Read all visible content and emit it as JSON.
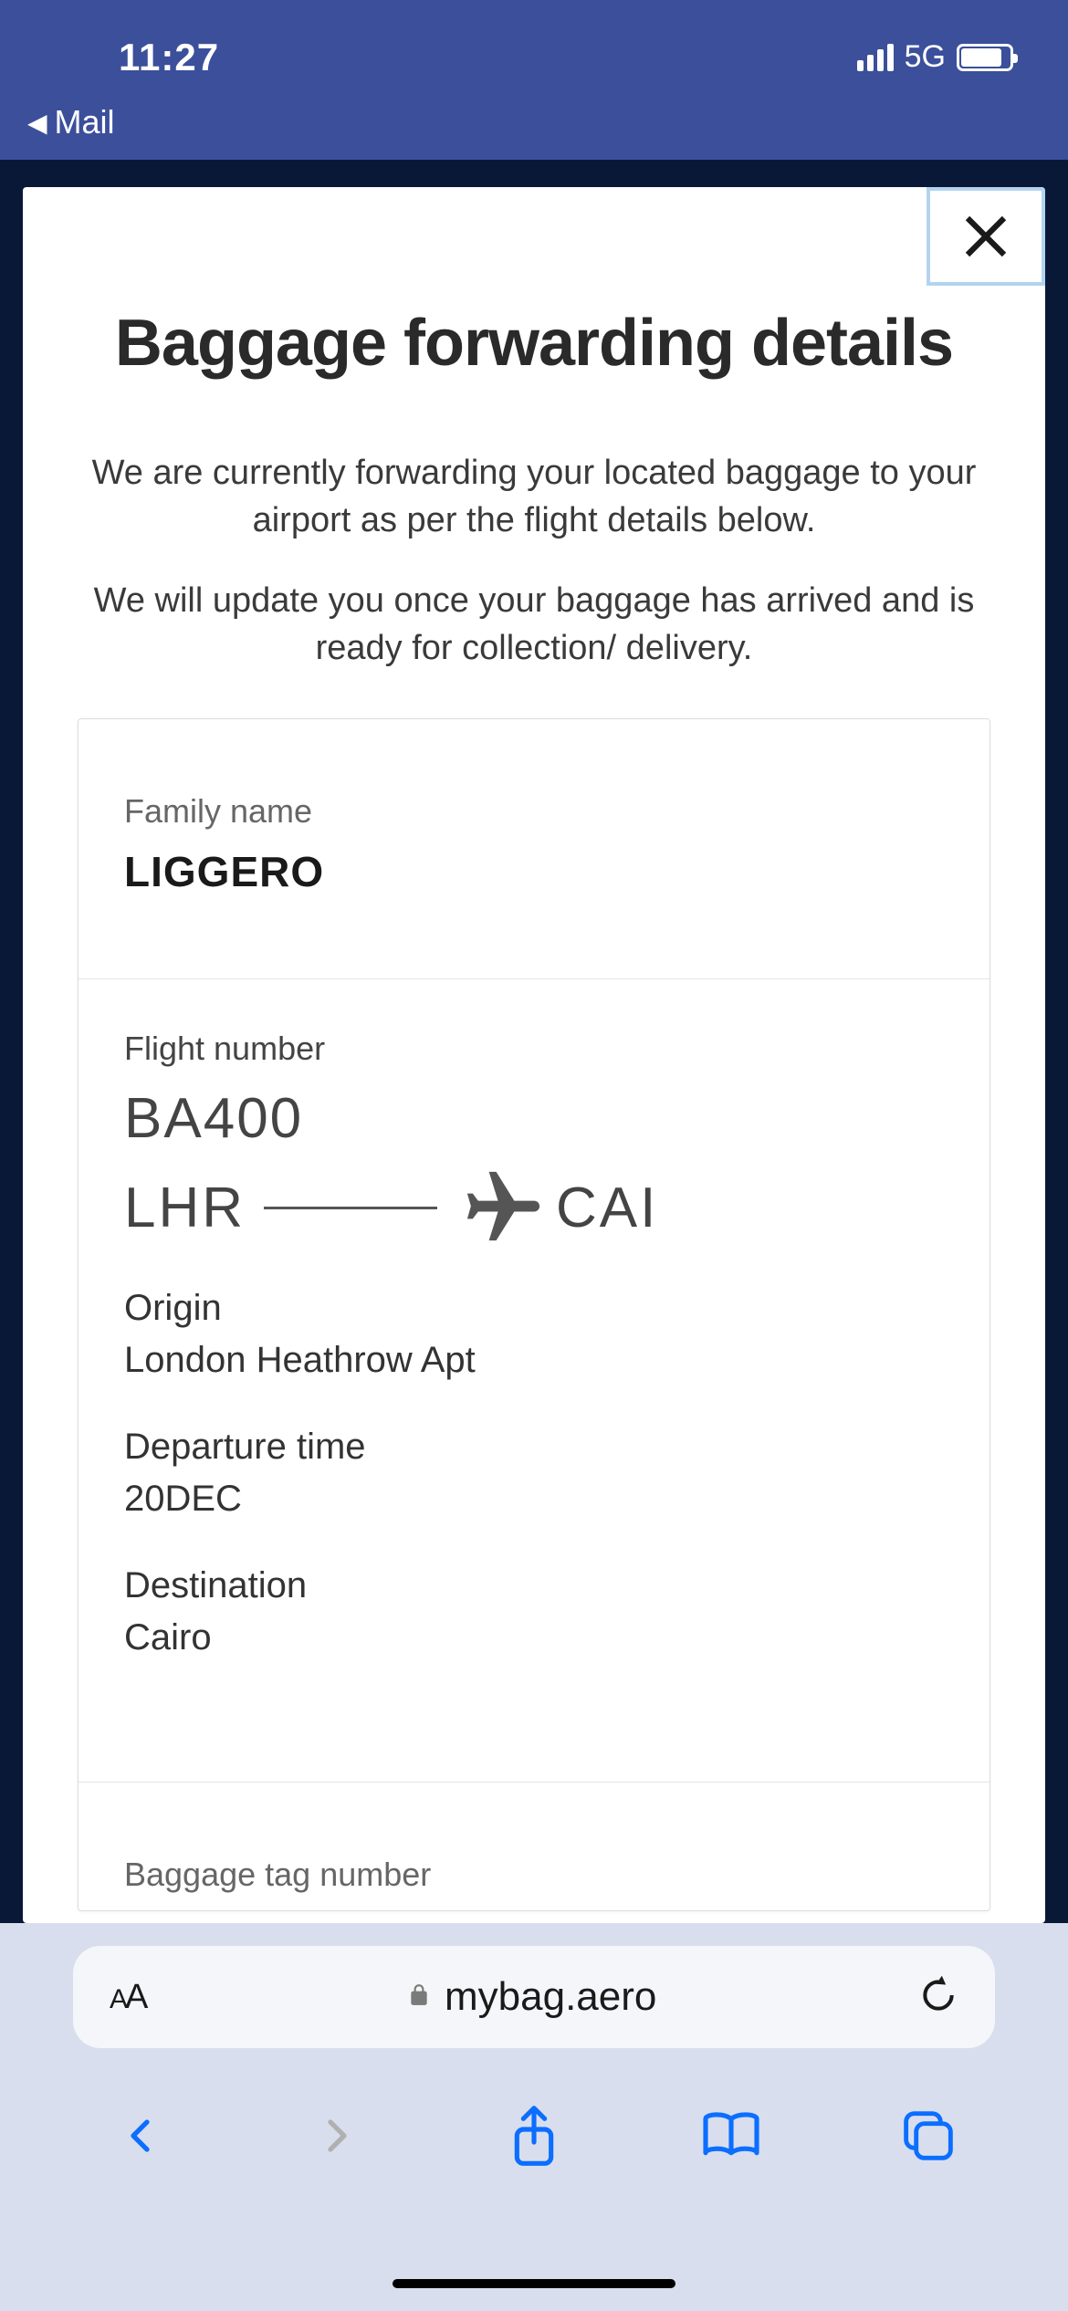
{
  "statusBar": {
    "time": "11:27",
    "networkType": "5G",
    "backApp": "Mail"
  },
  "page": {
    "title": "Baggage forwarding details",
    "intro1": "We are currently forwarding your located baggage to your airport as per the flight details below.",
    "intro2": "We will update you once your baggage has arrived and is ready for collection/ delivery."
  },
  "details": {
    "familyNameLabel": "Family name",
    "familyName": "LIGGERO",
    "flightNumberLabel": "Flight number",
    "flightNumber": "BA400",
    "originCode": "LHR",
    "destinationCode": "CAI",
    "originLabel": "Origin",
    "origin": "London Heathrow Apt",
    "departureTimeLabel": "Departure time",
    "departureTime": "20DEC",
    "destinationLabel": "Destination",
    "destination": "Cairo",
    "bagTagLabel": "Baggage tag number"
  },
  "browser": {
    "url": "mybag.aero"
  }
}
